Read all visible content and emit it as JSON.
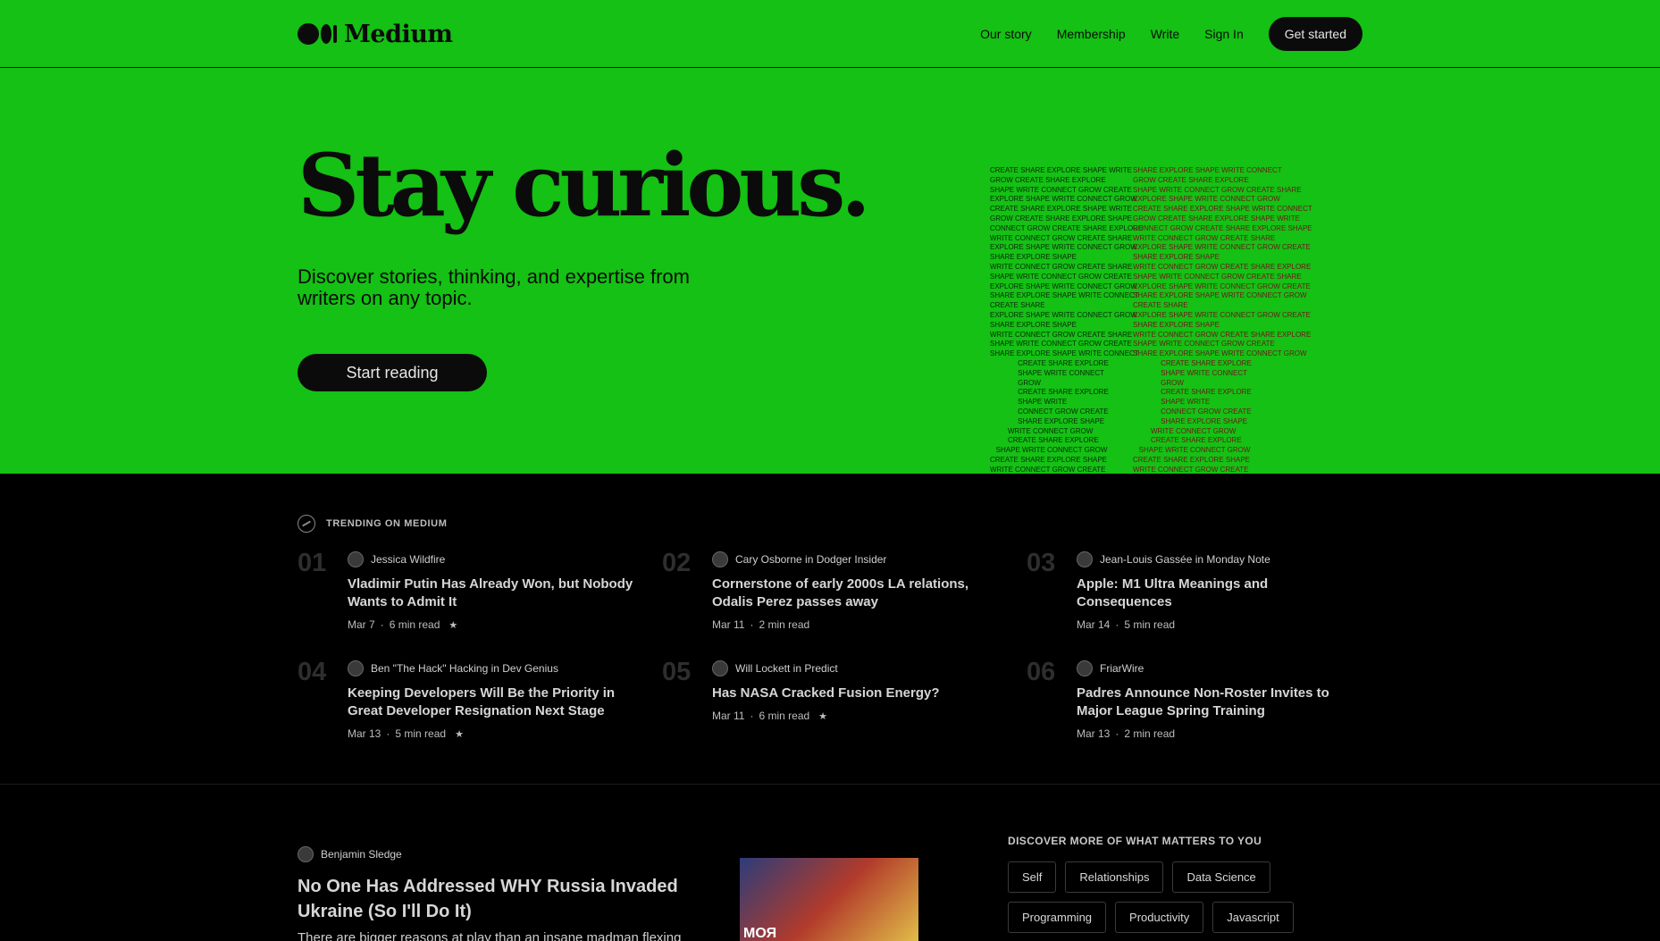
{
  "header": {
    "brand": "Medium",
    "nav": [
      {
        "label": "Our story"
      },
      {
        "label": "Membership"
      },
      {
        "label": "Write"
      },
      {
        "label": "Sign In"
      }
    ],
    "cta": "Get started"
  },
  "hero": {
    "title": "Stay curious.",
    "subtitle": "Discover stories, thinking, and expertise from writers on any topic.",
    "button": "Start reading",
    "art_left": [
      "CREATE SHARE EXPLORE SHAPE WRITE",
      "GROW CREATE SHARE EXPLORE",
      "SHAPE WRITE CONNECT GROW CREATE",
      "EXPLORE SHAPE WRITE CONNECT GROW",
      "CREATE SHARE EXPLORE SHAPE WRITE",
      "GROW CREATE SHARE EXPLORE SHAPE",
      "CONNECT GROW CREATE SHARE EXPLORE",
      "WRITE CONNECT GROW CREATE SHARE",
      "EXPLORE SHAPE WRITE CONNECT GROW",
      "SHARE EXPLORE SHAPE",
      "WRITE CONNECT GROW CREATE SHARE",
      "SHAPE WRITE CONNECT GROW CREATE",
      "EXPLORE SHAPE WRITE CONNECT GROW",
      "SHARE EXPLORE SHAPE WRITE CONNECT",
      "CREATE SHARE",
      "EXPLORE SHAPE WRITE CONNECT GROW",
      "SHARE EXPLORE SHAPE",
      "WRITE CONNECT GROW CREATE SHARE",
      "SHAPE WRITE CONNECT GROW CREATE",
      "SHARE EXPLORE SHAPE WRITE CONNECT",
      "              CREATE SHARE EXPLORE",
      "              SHAPE WRITE CONNECT",
      "              GROW",
      "              CREATE SHARE EXPLORE",
      "              SHAPE WRITE",
      "              CONNECT GROW CREATE",
      "              SHARE EXPLORE SHAPE",
      "         WRITE CONNECT GROW",
      "         CREATE SHARE EXPLORE",
      "   SHAPE WRITE CONNECT GROW",
      "CREATE SHARE EXPLORE SHAPE",
      "WRITE CONNECT GROW CREATE"
    ],
    "art_right": [
      "SHARE EXPLORE SHAPE WRITE CONNECT",
      "GROW CREATE SHARE EXPLORE",
      "SHAPE WRITE CONNECT GROW CREATE SHARE",
      "EXPLORE SHAPE WRITE CONNECT GROW",
      "CREATE SHARE EXPLORE SHAPE WRITE CONNECT",
      "GROW CREATE SHARE EXPLORE SHAPE WRITE",
      "CONNECT GROW CREATE SHARE EXPLORE SHAPE",
      "WRITE CONNECT GROW CREATE SHARE",
      "EXPLORE SHAPE WRITE CONNECT GROW CREATE",
      "SHARE EXPLORE SHAPE",
      "WRITE CONNECT GROW CREATE SHARE EXPLORE",
      "SHAPE WRITE CONNECT GROW CREATE SHARE",
      "EXPLORE SHAPE WRITE CONNECT GROW CREATE",
      "SHARE EXPLORE SHAPE WRITE CONNECT GROW",
      "CREATE SHARE",
      "EXPLORE SHAPE WRITE CONNECT GROW CREATE",
      "SHARE EXPLORE SHAPE",
      "WRITE CONNECT GROW CREATE SHARE EXPLORE",
      "SHAPE WRITE CONNECT GROW CREATE",
      "SHARE EXPLORE SHAPE WRITE CONNECT GROW",
      "              CREATE SHARE EXPLORE",
      "              SHAPE WRITE CONNECT",
      "              GROW",
      "              CREATE SHARE EXPLORE",
      "              SHAPE WRITE",
      "              CONNECT GROW CREATE",
      "              SHARE EXPLORE SHAPE",
      "         WRITE CONNECT GROW",
      "         CREATE SHARE EXPLORE",
      "   SHAPE WRITE CONNECT GROW",
      "CREATE SHARE EXPLORE SHAPE",
      "WRITE CONNECT GROW CREATE"
    ]
  },
  "trending": {
    "heading": "TRENDING ON MEDIUM",
    "items": [
      {
        "num": "01",
        "author": "Jessica Wildfire",
        "title": "Vladimir Putin Has Already Won, but Nobody Wants to Admit It",
        "date": "Mar 7",
        "read": "6 min read",
        "star": true
      },
      {
        "num": "02",
        "author": "Cary Osborne in Dodger Insider",
        "title": "Cornerstone of early 2000s LA relations, Odalis Perez passes away",
        "date": "Mar 11",
        "read": "2 min read",
        "star": false
      },
      {
        "num": "03",
        "author": "Jean-Louis Gassée in Monday Note",
        "title": "Apple: M1 Ultra Meanings and Consequences",
        "date": "Mar 14",
        "read": "5 min read",
        "star": false
      },
      {
        "num": "04",
        "author": "Ben \"The Hack\" Hacking in Dev Genius",
        "title": "Keeping Developers Will Be the Priority in Great Developer Resignation Next Stage",
        "date": "Mar 13",
        "read": "5 min read",
        "star": true
      },
      {
        "num": "05",
        "author": "Will Lockett in Predict",
        "title": "Has NASA Cracked Fusion Energy?",
        "date": "Mar 11",
        "read": "6 min read",
        "star": true
      },
      {
        "num": "06",
        "author": "FriarWire",
        "title": "Padres Announce Non-Roster Invites to Major League Spring Training",
        "date": "Mar 13",
        "read": "2 min read",
        "star": false
      }
    ]
  },
  "feed": {
    "post": {
      "author": "Benjamin Sledge",
      "title": "No One Has Addressed WHY Russia Invaded Ukraine (So I'll Do It)",
      "desc": "There are bigger reasons at play than an insane madman flexing",
      "thumb_text": "МОЯ"
    },
    "discover": {
      "title": "DISCOVER MORE OF WHAT MATTERS TO YOU",
      "tags": [
        "Self",
        "Relationships",
        "Data Science",
        "Programming",
        "Productivity",
        "Javascript"
      ]
    }
  },
  "colors": {
    "accent": "#14c114",
    "dark": "#0b0b0b"
  }
}
